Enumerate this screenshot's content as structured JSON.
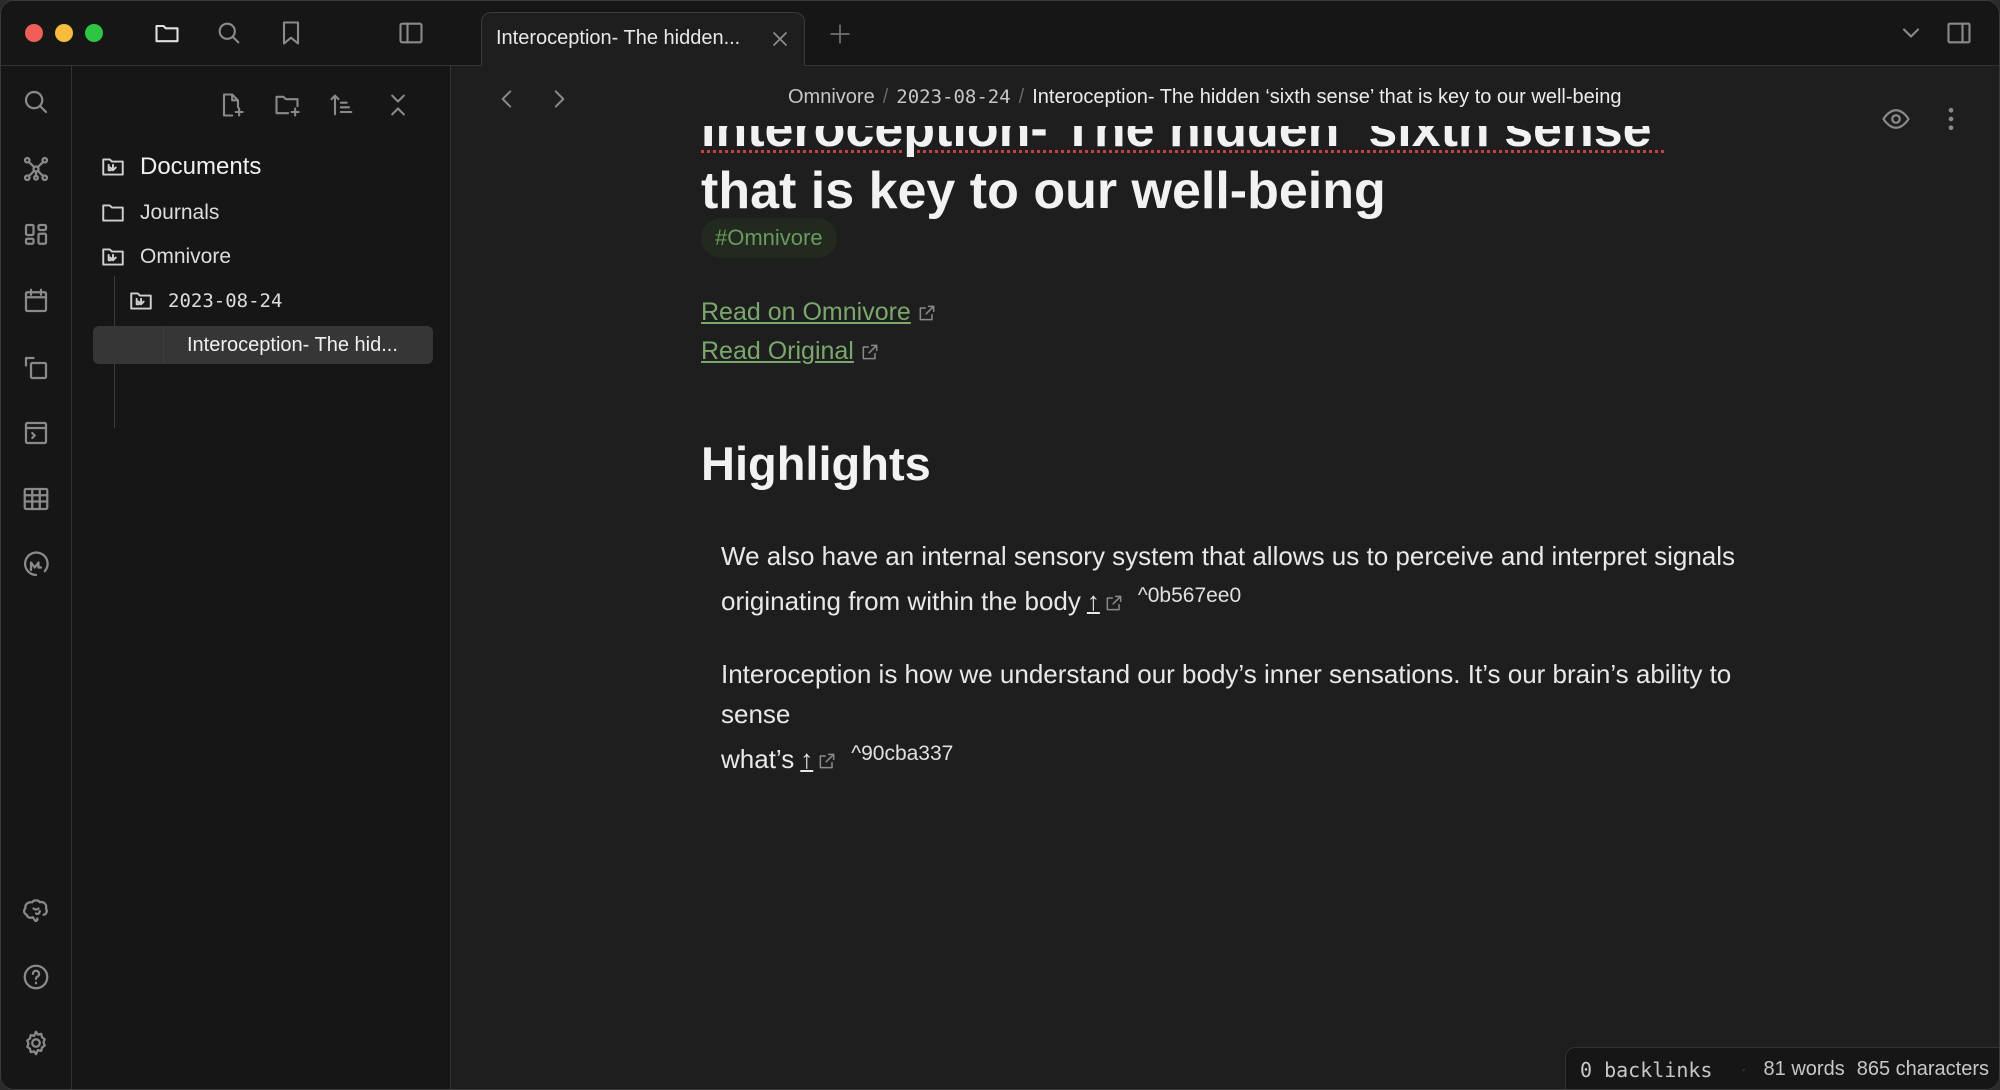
{
  "titlebar": {
    "tab_title": "Interoception- The hidden...",
    "icons": [
      "folder-icon",
      "search-icon",
      "bookmark-icon",
      "sidebar-toggle-icon"
    ],
    "right_icons": [
      "chevron-down-icon",
      "right-sidebar-toggle-icon"
    ]
  },
  "ribbon": {
    "top_icons": [
      "search-icon",
      "graph-icon",
      "dashboard-icon",
      "calendar-icon",
      "copy-icon",
      "terminal-icon",
      "table-icon",
      "omnivore-icon"
    ],
    "bottom_icons": [
      "brain-icon",
      "help-icon",
      "settings-icon"
    ]
  },
  "explorer": {
    "toolbar": [
      "new-note-icon",
      "new-folder-icon",
      "sort-icon",
      "collapse-all-icon"
    ],
    "tree": [
      {
        "label": "Documents",
        "icon": "folder-linked-icon"
      },
      {
        "label": "Journals",
        "icon": "folder-icon"
      },
      {
        "label": "Omnivore",
        "icon": "folder-linked-icon"
      },
      {
        "label": "2023-08-24",
        "icon": "folder-linked-icon"
      },
      {
        "label": "Interoception- The hid...",
        "icon": "",
        "active": true
      }
    ]
  },
  "header": {
    "breadcrumb": [
      "Omnivore",
      "2023-08-24",
      "Interoception- The hidden ‘sixth sense’ that is key to our well-being"
    ]
  },
  "document": {
    "title_line1": "Interoception- The hidden ‘sixth sense’",
    "title_line2": "that is key to our well-being",
    "tag": "#Omnivore",
    "links": [
      "Read on Omnivore",
      "Read Original"
    ],
    "highlights_heading": "Highlights",
    "highlights": [
      {
        "line1": "We also have an internal sensory system that allows us to perceive and interpret signals",
        "line2": "originating from within the body",
        "arrow": "↑",
        "block_id": "^0b567ee0"
      },
      {
        "line1": "Interoception is how we understand our body’s inner sensations. It’s our brain’s ability to sense",
        "line2": "what’s",
        "arrow": "↑",
        "block_id": "^90cba337"
      }
    ]
  },
  "status": {
    "backlinks": "0 backlinks",
    "words": "81 words",
    "characters": "865 characters"
  }
}
